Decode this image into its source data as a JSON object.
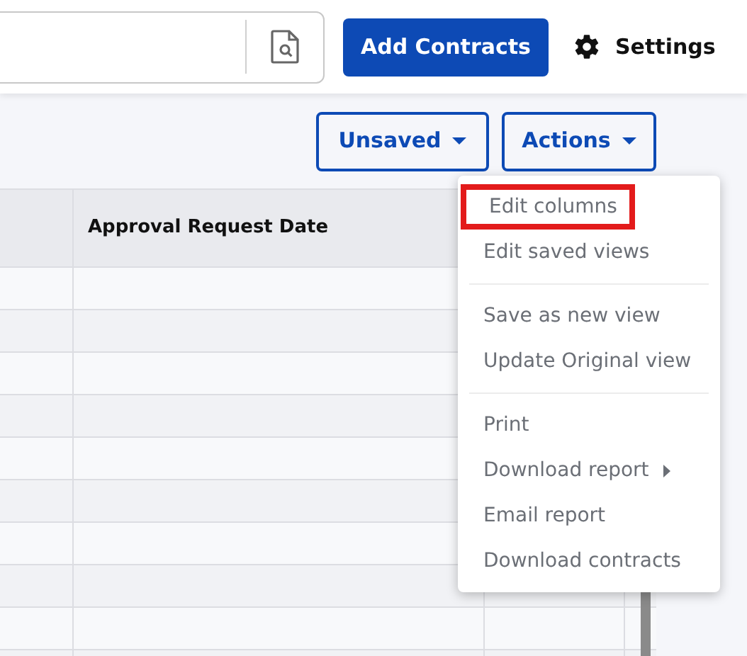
{
  "header": {
    "add_button": "Add Contracts",
    "settings": "Settings"
  },
  "toolbar": {
    "buttons": [
      {
        "label": "Unsaved"
      },
      {
        "label": "Actions"
      }
    ]
  },
  "table": {
    "columns": [
      null,
      "Approval Request Date",
      null,
      null
    ]
  },
  "actions_menu": {
    "groups": [
      [
        {
          "label": "Edit columns",
          "highlighted": true,
          "submenu": false
        },
        {
          "label": "Edit saved views",
          "highlighted": false,
          "submenu": false
        }
      ],
      [
        {
          "label": "Save as new view",
          "highlighted": false,
          "submenu": false
        },
        {
          "label": "Update Original view",
          "highlighted": false,
          "submenu": false
        }
      ],
      [
        {
          "label": "Print",
          "highlighted": false,
          "submenu": false
        },
        {
          "label": "Download report",
          "highlighted": false,
          "submenu": true
        },
        {
          "label": "Email report",
          "highlighted": false,
          "submenu": false
        },
        {
          "label": "Download contracts",
          "highlighted": false,
          "submenu": false
        }
      ]
    ]
  }
}
